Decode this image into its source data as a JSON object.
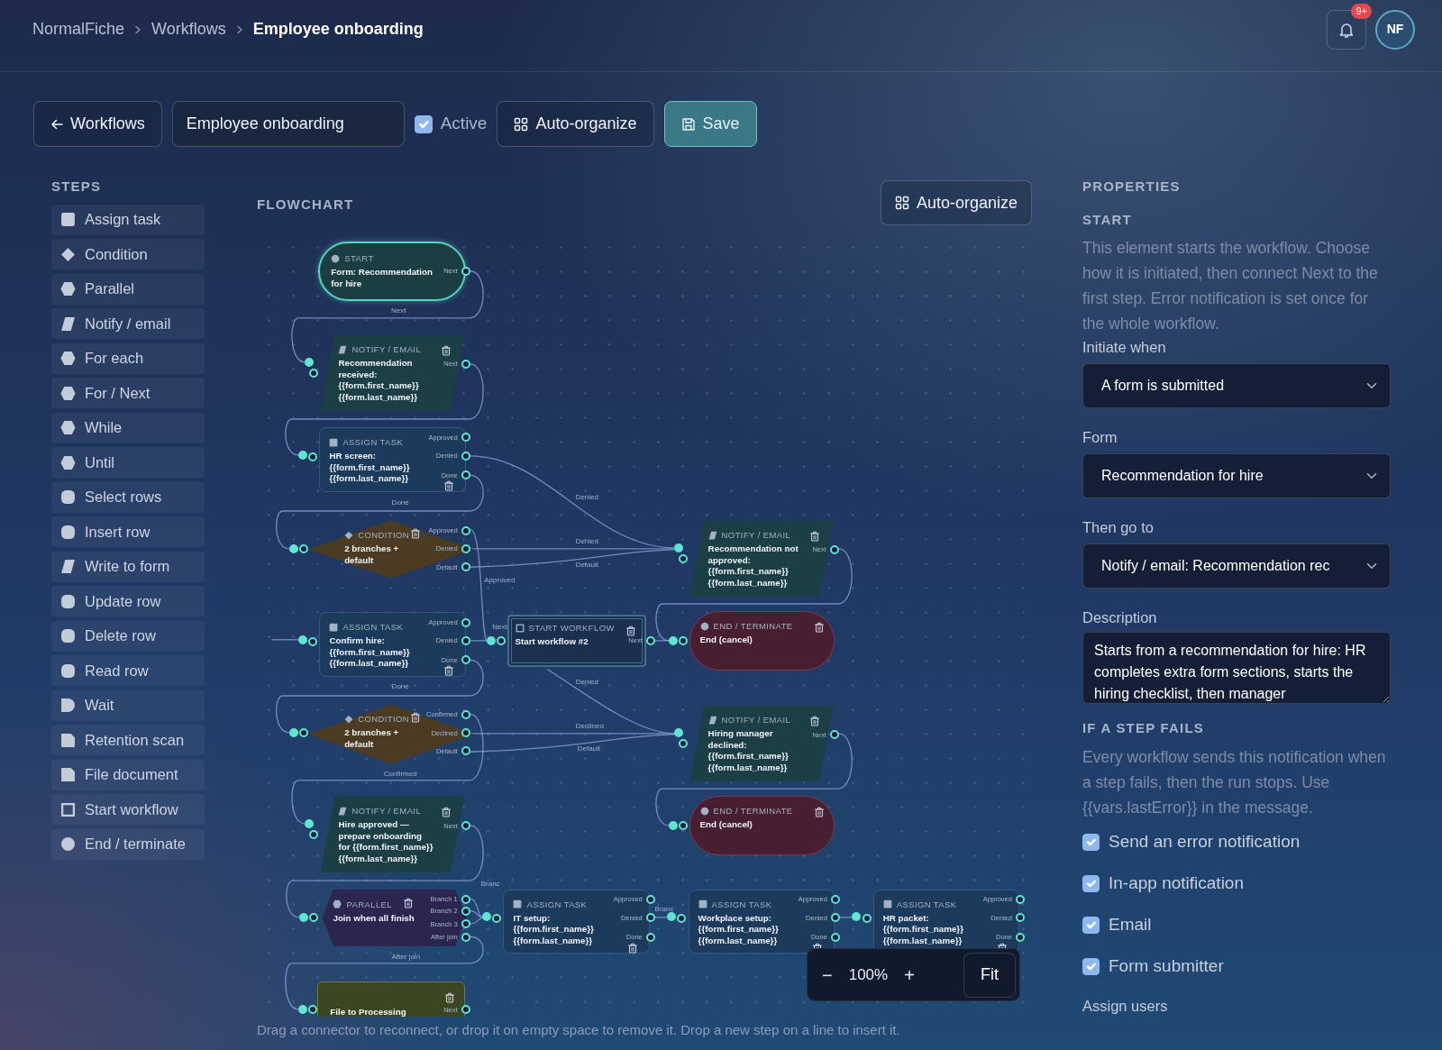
{
  "breadcrumb": [
    {
      "label": "NormalFiche",
      "current": false
    },
    {
      "label": "Workflows",
      "current": false
    },
    {
      "label": "Employee onboarding",
      "current": true
    }
  ],
  "notifications": {
    "badge": "9+"
  },
  "avatar": {
    "initials": "NF"
  },
  "toolbar": {
    "back_button": "Workflows",
    "name_value": "Employee onboarding",
    "active": {
      "label": "Active",
      "checked": true
    },
    "auto_organize": "Auto-organize",
    "save": "Save"
  },
  "steps": {
    "title": "STEPS",
    "items": [
      {
        "label": "Assign task",
        "kind": "square"
      },
      {
        "label": "Condition",
        "kind": "diamond"
      },
      {
        "label": "Parallel",
        "kind": "hexagon"
      },
      {
        "label": "Notify / email",
        "kind": "parallelogram"
      },
      {
        "label": "For each",
        "kind": "hexagon"
      },
      {
        "label": "For / Next",
        "kind": "hexagon"
      },
      {
        "label": "While",
        "kind": "hexagon"
      },
      {
        "label": "Until",
        "kind": "hexagon"
      },
      {
        "label": "Select rows",
        "kind": "rounded"
      },
      {
        "label": "Insert row",
        "kind": "rounded"
      },
      {
        "label": "Write to form",
        "kind": "parallelogram"
      },
      {
        "label": "Update row",
        "kind": "rounded"
      },
      {
        "label": "Delete row",
        "kind": "rounded"
      },
      {
        "label": "Read row",
        "kind": "rounded"
      },
      {
        "label": "Wait",
        "kind": "halfround"
      },
      {
        "label": "Retention scan",
        "kind": "document"
      },
      {
        "label": "File document",
        "kind": "document"
      },
      {
        "label": "Start workflow",
        "kind": "frame"
      },
      {
        "label": "End / terminate",
        "kind": "circle"
      }
    ]
  },
  "flowchart": {
    "title": "FLOWCHART",
    "auto_organize": "Auto-organize",
    "nodes": [
      {
        "kind": "start",
        "type_label": "START",
        "title": "Form: Recommendation for hire",
        "ports": [
          "Next"
        ],
        "selected": true
      },
      {
        "kind": "notify",
        "type_label": "NOTIFY / EMAIL",
        "title": "Recommendation received: {{form.first_name}} {{form.last_name}}",
        "ports": [
          "Next"
        ],
        "selected": false
      },
      {
        "kind": "assign",
        "type_label": "ASSIGN TASK",
        "title": "HR screen: {{form.first_name}} {{form.last_name}}",
        "ports": [
          "Approved",
          "Denied",
          "Done"
        ],
        "selected": false
      },
      {
        "kind": "condition",
        "type_label": "CONDITION",
        "title": "2 branches + default",
        "ports": [
          "Approved",
          "Denied",
          "Default"
        ],
        "selected": false
      },
      {
        "kind": "assign",
        "type_label": "ASSIGN TASK",
        "title": "Confirm hire: {{form.first_name}} {{form.last_name}}",
        "ports": [
          "Approved",
          "Denied",
          "Done"
        ],
        "selected": false
      },
      {
        "kind": "condition",
        "type_label": "CONDITION",
        "title": "2 branches + default",
        "ports": [
          "Confirmed",
          "Declined",
          "Default"
        ],
        "selected": false
      },
      {
        "kind": "notify",
        "type_label": "NOTIFY / EMAIL",
        "title": "Hire approved — prepare onboarding for {{form.first_name}} {{form.last_name}}",
        "ports": [
          "Next"
        ],
        "selected": false
      },
      {
        "kind": "parallel",
        "type_label": "PARALLEL",
        "title": "Join when all finish",
        "ports": [
          "Branch 1",
          "Branch 2",
          "Branch 3",
          "After join"
        ],
        "selected": false
      },
      {
        "kind": "file",
        "title": "File to Processing",
        "ports": [
          "Next"
        ],
        "selected": false
      },
      {
        "kind": "startwf",
        "type_label": "START WORKFLOW",
        "title": "Start workflow #2",
        "ports": [
          "Next"
        ],
        "selected": false
      },
      {
        "kind": "notify",
        "type_label": "NOTIFY / EMAIL",
        "title": "Recommendation not approved: {{form.first_name}} {{form.last_name}}",
        "ports": [
          "Next"
        ],
        "selected": false
      },
      {
        "kind": "end",
        "type_label": "END / TERMINATE",
        "title": "End (cancel)",
        "selected": false
      },
      {
        "kind": "notify",
        "type_label": "NOTIFY / EMAIL",
        "title": "Hiring manager declined: {{form.first_name}} {{form.last_name}}",
        "ports": [
          "Next"
        ],
        "selected": false
      },
      {
        "kind": "end",
        "type_label": "END / TERMINATE",
        "title": "End (cancel)",
        "selected": false
      },
      {
        "kind": "assign",
        "type_label": "ASSIGN TASK",
        "title": "IT setup: {{form.first_name}} {{form.last_name}}",
        "ports": [
          "Approved",
          "Denied",
          "Done"
        ],
        "selected": false
      },
      {
        "kind": "assign",
        "type_label": "ASSIGN TASK",
        "title": "Workplace setup: {{form.first_name}} {{form.last_name}}",
        "ports": [
          "Approved",
          "Denied",
          "Done"
        ],
        "selected": false
      },
      {
        "kind": "assign",
        "type_label": "ASSIGN TASK",
        "title": "HR packet: {{form.first_name}} {{form.last_name}}",
        "ports": [
          "Approved",
          "Denied",
          "Done"
        ],
        "selected": false
      }
    ],
    "edge_labels": [
      "Next",
      "Done",
      "Denied",
      "Denied",
      "Default",
      "Approved",
      "Next",
      "Done",
      "Denied",
      "Declined",
      "Default",
      "Confirmed",
      "Branc",
      "Branc",
      "After join"
    ],
    "zoom": {
      "minus": "−",
      "level": "100%",
      "plus": "+",
      "fit": "Fit"
    },
    "hint": "Drag a connector to reconnect, or drop it on empty space to remove it. Drop a new step on a line to insert it."
  },
  "properties": {
    "title": "PROPERTIES",
    "section": "START",
    "intro": "This element starts the workflow. Choose how it is initiated, then connect Next to the first step. Error notification is set once for the whole workflow.",
    "fields": [
      {
        "label": "Initiate when",
        "kind": "select",
        "value": "A form is submitted"
      },
      {
        "label": "Form",
        "kind": "select",
        "value": "Recommendation for hire"
      },
      {
        "label": "Then go to",
        "kind": "select",
        "value": "Notify / email: Recommendation rec"
      },
      {
        "label": "Description",
        "kind": "textarea",
        "value": "Starts from a recommendation for hire: HR completes extra form sections, starts the hiring checklist, then manager"
      }
    ],
    "error_title": "IF A STEP FAILS",
    "error_text": "Every workflow sends this notification when a step fails, then the run stops. Use {{vars.lastError}} in the message.",
    "options": [
      {
        "label": "Send an error notification",
        "checked": true
      },
      {
        "label": "In-app notification",
        "checked": true
      },
      {
        "label": "Email",
        "checked": true
      },
      {
        "label": "Form submitter",
        "checked": true
      }
    ],
    "next_label": "Assign users"
  }
}
